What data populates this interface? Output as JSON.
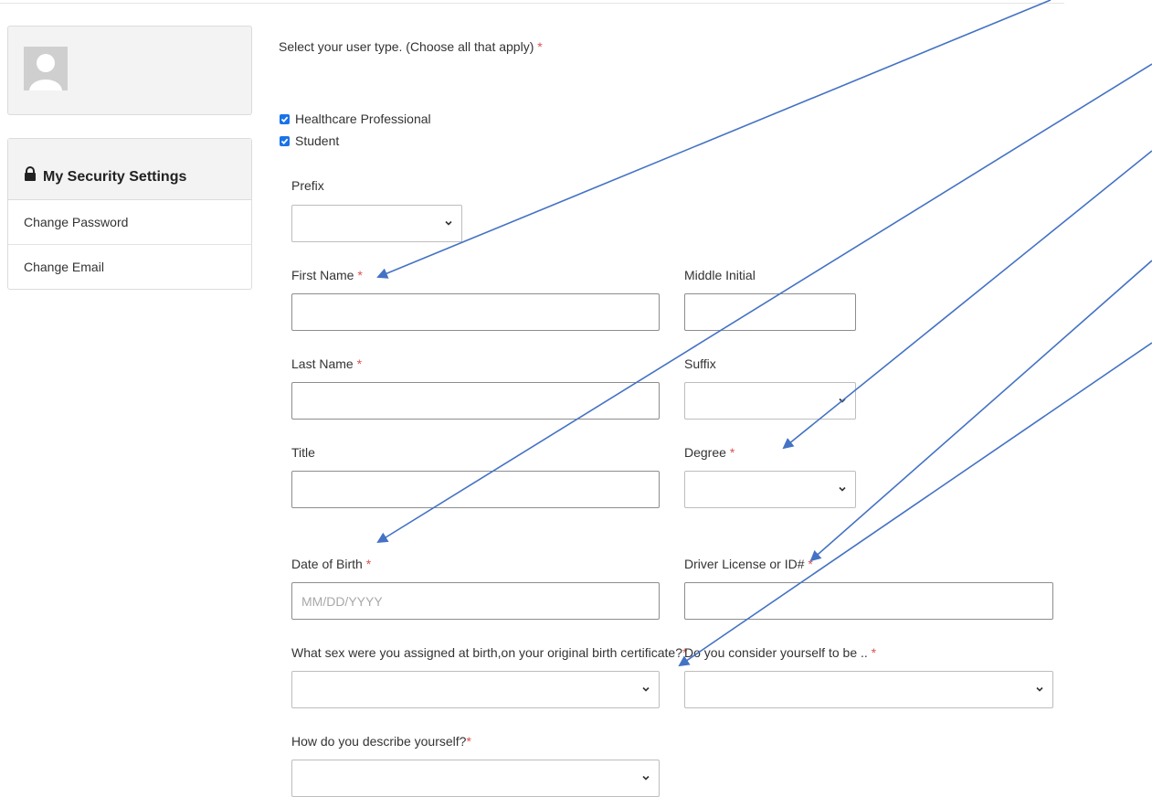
{
  "sidebar": {
    "security_title": "My Security Settings",
    "items": [
      {
        "label": "Change Password"
      },
      {
        "label": "Change Email"
      }
    ]
  },
  "form": {
    "user_type_prompt": "Select your user type. (Choose all that apply)",
    "user_types": [
      {
        "label": "Healthcare Professional",
        "checked": true
      },
      {
        "label": "Student",
        "checked": true
      }
    ],
    "required_mark": "*",
    "prefix": {
      "label": "Prefix",
      "value": ""
    },
    "first_name": {
      "label": "First Name",
      "value": ""
    },
    "middle_initial": {
      "label": "Middle Initial",
      "value": ""
    },
    "last_name": {
      "label": "Last Name",
      "value": ""
    },
    "suffix": {
      "label": "Suffix",
      "value": ""
    },
    "title": {
      "label": "Title",
      "value": ""
    },
    "degree": {
      "label": "Degree",
      "value": ""
    },
    "dob": {
      "label": "Date of Birth",
      "placeholder": "MM/DD/YYYY",
      "value": ""
    },
    "driver_license": {
      "label": "Driver License or ID#",
      "value": ""
    },
    "sex_at_birth": {
      "label": "What sex were you assigned at birth,on your original birth certificate?",
      "value": ""
    },
    "consider_yourself": {
      "label": "Do you consider yourself to be ..",
      "value": ""
    },
    "describe_yourself": {
      "label": "How do you describe yourself?",
      "value": ""
    }
  },
  "colors": {
    "accent": "#1a73e8",
    "required": "#d9534f",
    "annotation_arrow": "#4472c4"
  }
}
